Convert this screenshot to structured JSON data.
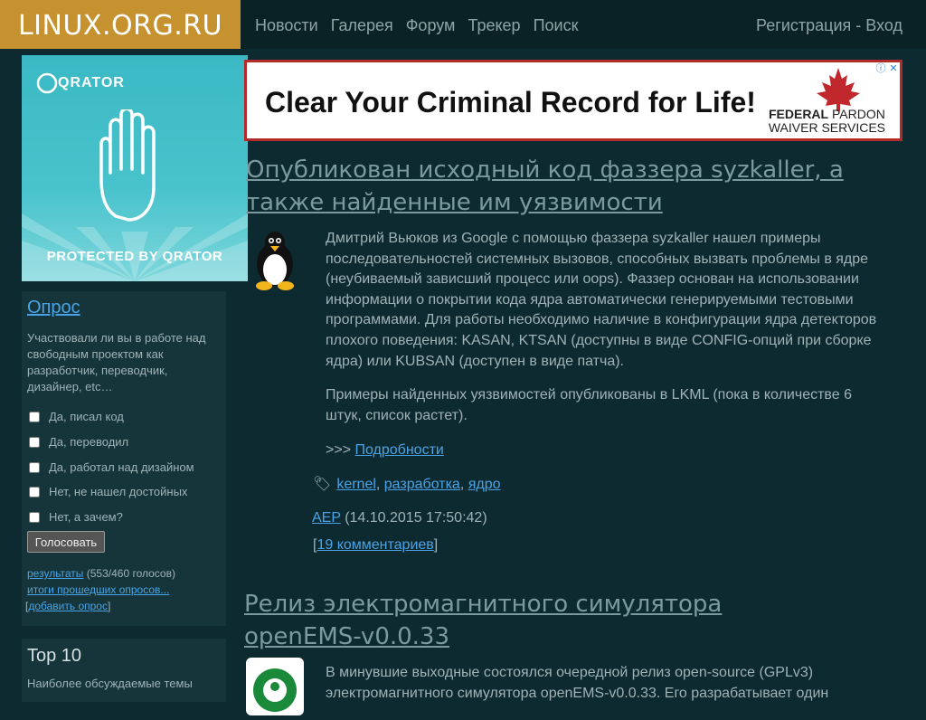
{
  "header": {
    "logo": "LINUX.ORG.RU",
    "nav": [
      "Новости",
      "Галерея",
      "Форум",
      "Трекер",
      "Поиск"
    ],
    "auth": "Регистрация - Вход"
  },
  "qrator": {
    "logo": "QRATOR",
    "caption": "PROTECTED BY QRATOR"
  },
  "poll": {
    "title": "Опрос",
    "question": "Участвовали ли вы в работе над свободным проектом как разработчик, переводчик, дизайнер, etc…",
    "options": [
      "Да, писал код",
      "Да, переводил",
      "Да, работал над дизайном",
      "Нет, не нашел достойных",
      "Нет, а зачем?"
    ],
    "vote_button": "Голосовать",
    "results_link": "результаты",
    "results_count": "(553/460 голосов)",
    "past_polls": "итоги прошедших опросов...",
    "add_poll": "добавить опрос"
  },
  "top10": {
    "title": "Top 10",
    "subtitle": "Наиболее обсуждаемые темы"
  },
  "ad": {
    "headline": "Clear Your Criminal Record for Life!",
    "brand_line1_bold": "FEDERAL",
    "brand_line1_rest": " PARDON",
    "brand_line2": "WAIVER SERVICES"
  },
  "article1": {
    "title": "Опубликован исходный код фаззера syzkaller, а также найденные им уязвимости",
    "p1": "Дмитрий Вьюков из Google с помощью фаззера syzkaller нашел примеры последовательностей системных вызовов, способных вызвать проблемы в ядре (неубиваемый зависший процесс или oops). Фаззер основан на использовании информации о покрытии кода ядра автоматически генерируемыми тестовыми программами. Для работы необходимо наличие в конфигурации ядра детекторов плохого поведения: KASAN, KTSAN (доступны в виде CONFIG-опций при сборке ядра) или KUBSAN (доступен в виде патча).",
    "p2": "Примеры найденных уязвимостей опубликованы в LKML (пока в количестве 6 штук, список растет).",
    "more_prefix": ">>> ",
    "more_link": "Подробности",
    "tags": [
      "kernel",
      "разработка",
      "ядро"
    ],
    "author": "AEP",
    "date": "(14.10.2015 17:50:42)",
    "comments": "19 комментариев"
  },
  "article2": {
    "title": "Релиз электромагнитного симулятора openEMS-v0.0.33",
    "p1": "В минувшие выходные состоялся очередной релиз open-source (GPLv3) электромагнитного симулятора openEMS-v0.0.33. Его разрабатывает один"
  },
  "colors": {
    "background": "#0d2a30",
    "logo_bg": "#c6922f",
    "link": "#4aa3e6",
    "panel": "#15353b",
    "ad_border": "#b32a2a"
  }
}
